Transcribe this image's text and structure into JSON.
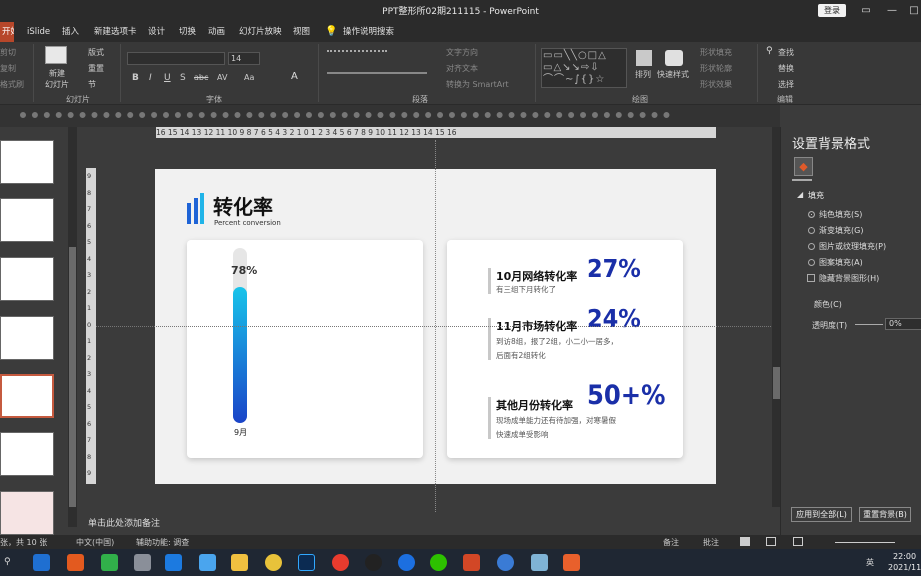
{
  "window": {
    "title": "PPT整形所02期211115 - PowerPoint",
    "login": "登录"
  },
  "tabs": [
    "开始",
    "iSlide",
    "插入",
    "新建选项卡",
    "设计",
    "切换",
    "动画",
    "幻灯片放映",
    "视图"
  ],
  "tell_me": "操作说明搜索",
  "ribbon": {
    "clipboard": {
      "cut": "剪切",
      "copy": "复制",
      "format": "格式刷"
    },
    "slides": {
      "new_slide": "新建\n幻灯片",
      "layout": "版式",
      "reset": "重置",
      "section": "节",
      "group": "幻灯片"
    },
    "font": {
      "size": "14",
      "group": "字体",
      "bold": "B",
      "italic": "I",
      "underline": "U",
      "shadow": "S",
      "strike": "abc",
      "spacing": "AV",
      "case": "Aa"
    },
    "paragraph": {
      "text_dir": "文字方向",
      "align": "对齐文本",
      "smartart": "转换为 SmartArt",
      "group": "段落"
    },
    "drawing": {
      "arrange": "排列",
      "quick_styles": "快速样式",
      "fill": "形状填充",
      "outline": "形状轮廓",
      "effects": "形状效果",
      "group": "绘图"
    },
    "editing": {
      "find": "查找",
      "replace": "替换",
      "select": "选择",
      "group": "编辑"
    }
  },
  "ruler": "16 15 14 13 12 11 10 9 8 7 6 5 4 3 2 1 0 1 2 3 4 5 6 7 8 9 10 11 12 13 14 15 16",
  "vruler": [
    "9",
    "8",
    "7",
    "6",
    "5",
    "4",
    "3",
    "2",
    "1",
    "0",
    "1",
    "2",
    "3",
    "4",
    "5",
    "6",
    "7",
    "8",
    "9"
  ],
  "slide": {
    "title": "转化率",
    "subtitle": "Percent conversion",
    "gauge": {
      "value": "78%",
      "percent": 78,
      "label": "9月"
    },
    "items": [
      {
        "title": "10月网络转化率",
        "pct": "27%",
        "desc": [
          "有三组下月转化了"
        ]
      },
      {
        "title": "11月市场转化率",
        "pct": "24%",
        "desc": [
          "到访8组，报了2组，小二小一居多，",
          "后面有2组转化"
        ]
      },
      {
        "title": "其他月份转化率",
        "pct": "50+%",
        "desc": [
          "现场成单能力还有待加强，对寒暑假",
          "快速成单受影响"
        ]
      }
    ]
  },
  "notes": "单击此处添加备注",
  "status": {
    "slide_info": "张，共 10 张",
    "language": "中文(中国)",
    "accessibility": "辅助功能: 调查",
    "notes_btn": "备注",
    "comments_btn": "批注"
  },
  "pane": {
    "title": "设置背景格式",
    "section": "填充",
    "options": [
      {
        "label": "纯色填充(S)",
        "selected": true
      },
      {
        "label": "渐变填充(G)",
        "selected": false
      },
      {
        "label": "图片或纹理填充(P)",
        "selected": false
      },
      {
        "label": "图案填充(A)",
        "selected": false
      }
    ],
    "hide_bg": "隐藏背景图形(H)",
    "color_label": "颜色(C)",
    "transparency_label": "透明度(T)",
    "transparency_value": "0%",
    "apply_all": "应用到全部(L)",
    "reset_bg": "重置背景(B)"
  },
  "taskbar": {
    "time": "22:00",
    "date": "2021/11",
    "ime": "英"
  }
}
